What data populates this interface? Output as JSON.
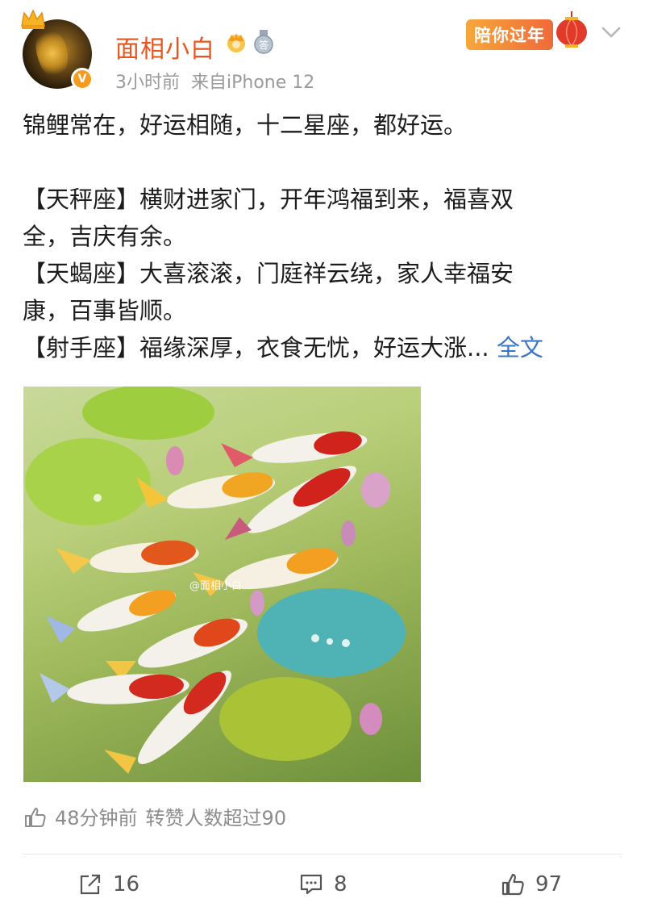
{
  "post": {
    "author": {
      "name": "面相小白",
      "time": "3小时前",
      "source": "来自iPhone 12"
    },
    "festival_badge": "陪你过年",
    "lines": [
      "锦鲤常在，好运相随，十二星座，都好运。",
      "",
      "【天秤座】横财进家门，开年鸿福到来，福喜双",
      "全，吉庆有余。",
      "【天蝎座】大喜滚滚，门庭祥云绕，家人幸福安",
      "康，百事皆顺。",
      "【射手座】福缘深厚，衣食无忧，好运大涨..."
    ],
    "full_text_link": "全文",
    "image": {
      "watermark": "@面相小白"
    },
    "repost_info": {
      "time": "48分钟前",
      "text": "转赞人数超过90"
    },
    "actions": {
      "share_count": "16",
      "comment_count": "8",
      "like_count": "97"
    },
    "icons": {
      "verified": "verified-icon",
      "crown": "crown-badge-icon",
      "medal": "medal-badge-icon",
      "lantern": "lantern-icon",
      "menu": "chevron-down-icon",
      "share": "share-icon",
      "comment": "comment-icon",
      "like": "thumbs-up-icon"
    },
    "colors": {
      "username": "#e8551f",
      "link": "#3a76c6",
      "meta": "#9a9a9a"
    }
  }
}
